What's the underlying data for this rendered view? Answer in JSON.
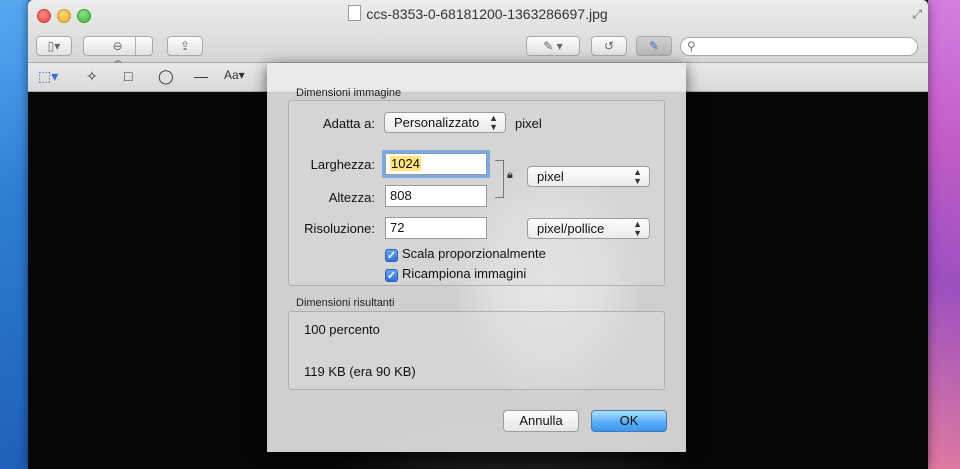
{
  "window": {
    "title": "ccs-8353-0-68181200-1363286697.jpg"
  },
  "icons": {
    "sidebar": "sidebar-icon",
    "zoom_out": "zoom-out-icon",
    "zoom_in": "zoom-in-icon",
    "share": "share-icon",
    "markup_pen": "pen-icon",
    "rotate": "rotate-icon",
    "edit_toolbar": "edit-toolbar-icon",
    "search": "search-icon",
    "rect_selection": "rect-selection-icon",
    "instant_alpha": "magic-wand-icon",
    "rectangle": "rectangle-icon",
    "oval": "oval-icon",
    "line": "line-icon",
    "text": "text-icon",
    "lock": "lock-icon"
  },
  "dialog": {
    "image_dimensions_heading": "Dimensioni immagine",
    "fit_label": "Adatta a:",
    "fit_value": "Personalizzato",
    "fit_unit": "pixel",
    "width_label": "Larghezza:",
    "width_value": "1024",
    "height_label": "Altezza:",
    "height_value": "808",
    "size_unit_value": "pixel",
    "resolution_label": "Risoluzione:",
    "resolution_value": "72",
    "resolution_unit_value": "pixel/pollice",
    "scale_proportionally": {
      "label": "Scala proporzionalmente",
      "checked": true
    },
    "resample_image": {
      "label": "Ricampiona immagini",
      "checked": true
    },
    "resulting_heading": "Dimensioni risultanti",
    "resulting_percent": "100 percento",
    "resulting_size": "119 KB (era 90 KB)",
    "cancel_label": "Annulla",
    "ok_label": "OK"
  },
  "colors": {
    "accent": "#3d97ee",
    "selection_highlight": "#ffe680"
  }
}
